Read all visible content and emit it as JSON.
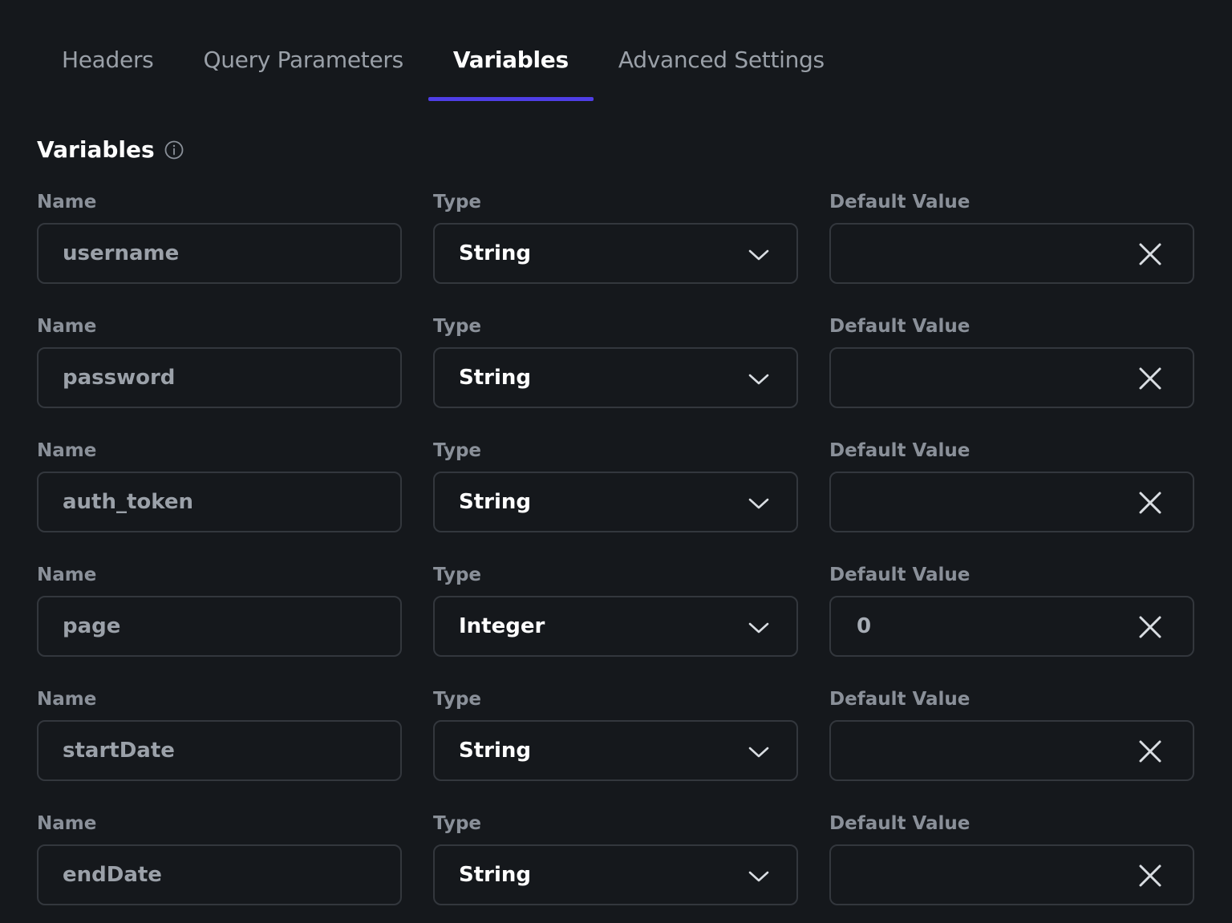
{
  "tabs": [
    {
      "label": "Headers",
      "active": false
    },
    {
      "label": "Query Parameters",
      "active": false
    },
    {
      "label": "Variables",
      "active": true
    },
    {
      "label": "Advanced Settings",
      "active": false
    }
  ],
  "section": {
    "title": "Variables",
    "info_icon": "info-icon"
  },
  "labels": {
    "name": "Name",
    "type": "Type",
    "default_value": "Default Value"
  },
  "variables": [
    {
      "name": "username",
      "type": "String",
      "default_value": ""
    },
    {
      "name": "password",
      "type": "String",
      "default_value": ""
    },
    {
      "name": "auth_token",
      "type": "String",
      "default_value": ""
    },
    {
      "name": "page",
      "type": "Integer",
      "default_value": "0"
    },
    {
      "name": "startDate",
      "type": "String",
      "default_value": ""
    },
    {
      "name": "endDate",
      "type": "String",
      "default_value": ""
    }
  ],
  "colors": {
    "background": "#15181c",
    "accent": "#4f3ee6",
    "border": "#33373d"
  }
}
